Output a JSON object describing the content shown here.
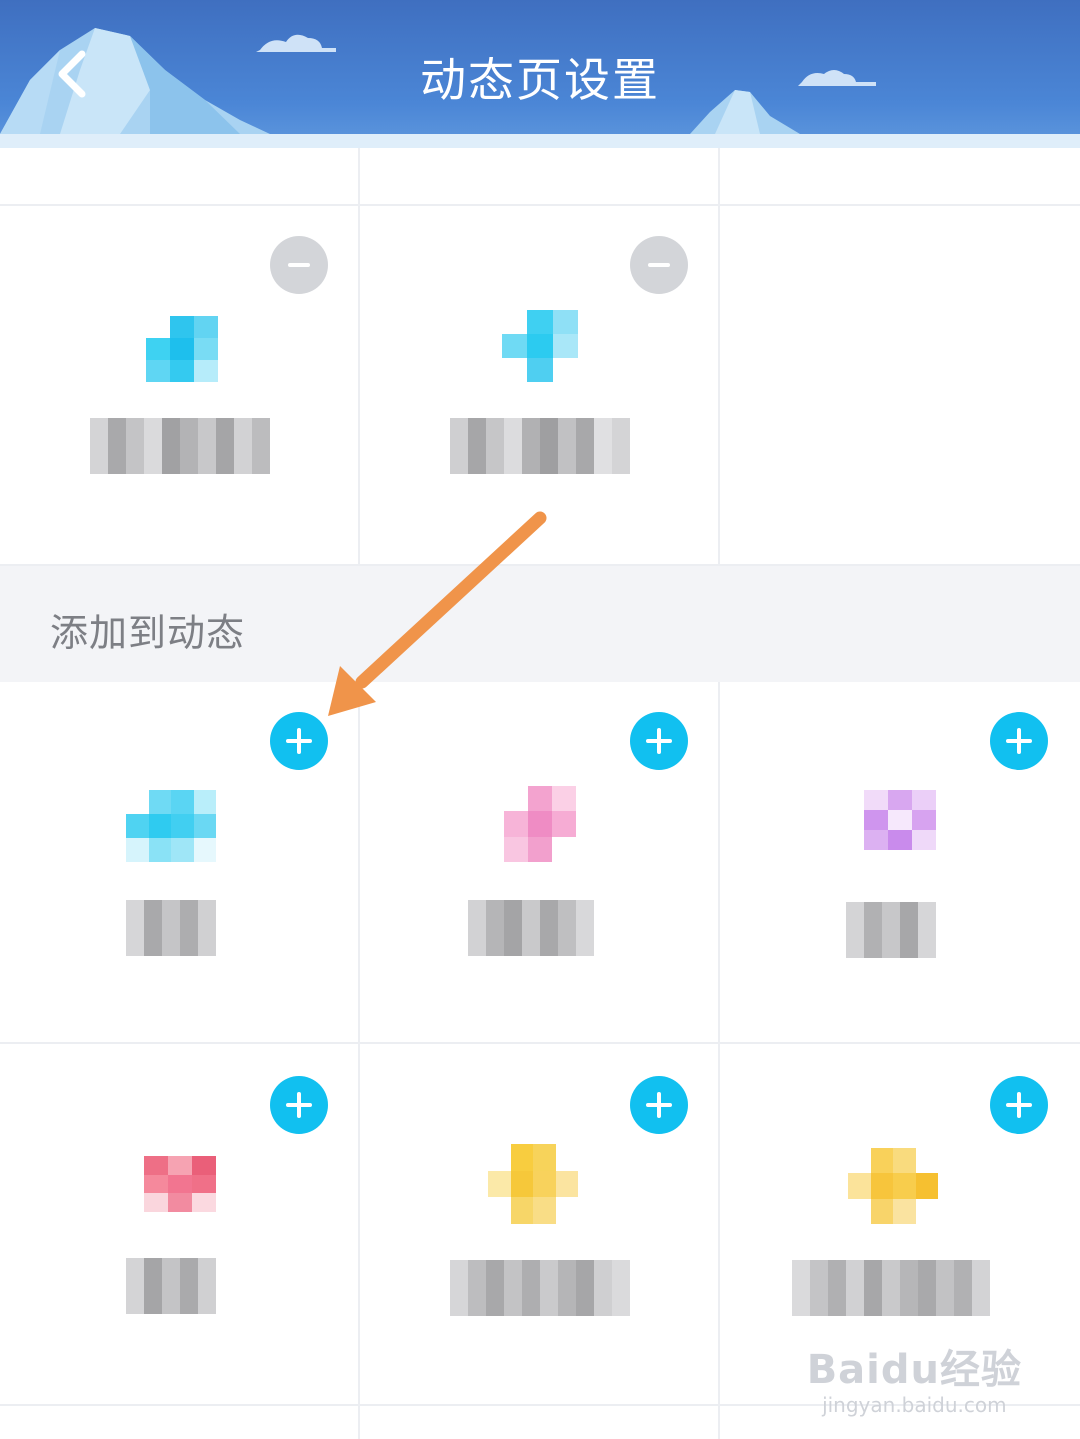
{
  "header": {
    "title": "动态页设置",
    "back_icon": "chevron-left-icon",
    "background_color": "#4b86d6"
  },
  "section": {
    "title": "添加到动态"
  },
  "colors": {
    "add_button": "#11c0f0",
    "remove_button": "#d3d5d9",
    "arrow": "#f0944a"
  },
  "watermark": {
    "logo": "Baidu经验",
    "url": "jingyan.baidu.com"
  },
  "current_items": [
    {
      "icon": "blurred-cyan-icon",
      "action": "remove-icon"
    },
    {
      "icon": "blurred-cyan-icon",
      "action": "remove-icon"
    }
  ],
  "add_items": [
    {
      "icon": "blurred-cyan-icon",
      "action": "plus-icon"
    },
    {
      "icon": "blurred-pink-icon",
      "action": "plus-icon"
    },
    {
      "icon": "blurred-purple-icon",
      "action": "plus-icon"
    },
    {
      "icon": "blurred-red-icon",
      "action": "plus-icon"
    },
    {
      "icon": "blurred-crown-icon",
      "action": "plus-icon"
    },
    {
      "icon": "blurred-yellow-icon",
      "action": "plus-icon"
    }
  ]
}
